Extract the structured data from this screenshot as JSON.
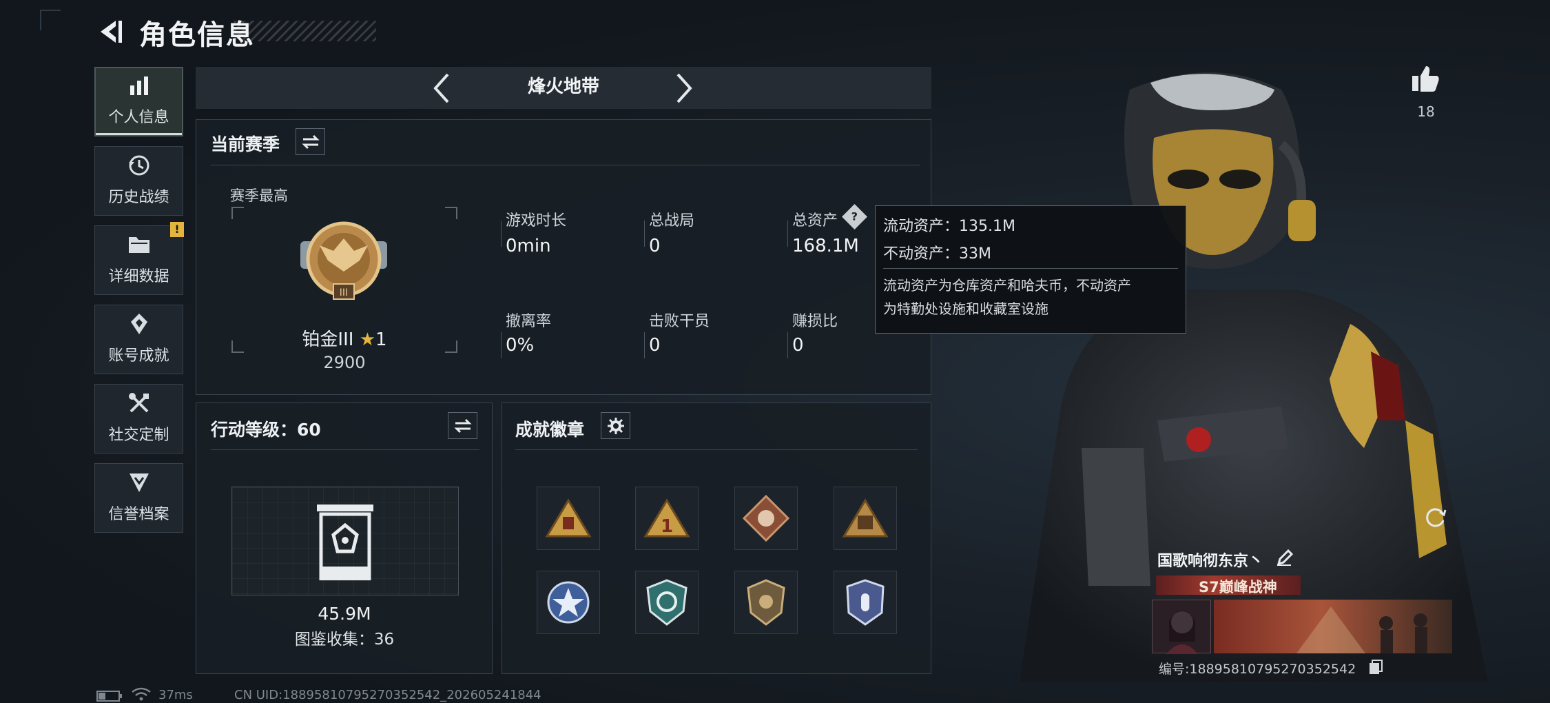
{
  "header": {
    "title": "角色信息"
  },
  "sidebar": {
    "items": [
      {
        "label": "个人信息",
        "icon": "bar-chart-icon"
      },
      {
        "label": "历史战绩",
        "icon": "history-icon"
      },
      {
        "label": "详细数据",
        "icon": "folder-icon",
        "badge": "!"
      },
      {
        "label": "账号成就",
        "icon": "achievement-icon"
      },
      {
        "label": "社交定制",
        "icon": "tools-icon"
      },
      {
        "label": "信誉档案",
        "icon": "credit-icon"
      }
    ]
  },
  "mode": {
    "title": "烽火地带"
  },
  "season": {
    "title": "当前赛季",
    "best_label": "赛季最高",
    "rank_name": "铂金III",
    "rank_stars": "1",
    "rank_score": "2900",
    "stats": [
      {
        "label": "游戏时长",
        "value": "0min"
      },
      {
        "label": "总战局",
        "value": "0"
      },
      {
        "label": "总资产",
        "value": "168.1M",
        "help": "?"
      },
      {
        "label": "撤离率",
        "value": "0%"
      },
      {
        "label": "击败干员",
        "value": "0"
      },
      {
        "label": "赚损比",
        "value": "0"
      }
    ]
  },
  "tooltip": {
    "liquid": "流动资产：135.1M",
    "fixed": "不动资产：33M",
    "desc_line1": "流动资产为仓库资产和哈夫币，不动资产",
    "desc_line2": "为特勤处设施和收藏室设施"
  },
  "action": {
    "title": "行动等级：60",
    "value": "45.9M",
    "collection": "图鉴收集：36"
  },
  "badges": {
    "title": "成就徽章",
    "items": [
      "triangle-gold-badge-icon",
      "triangle-number-one-badge-icon",
      "diamond-wolf-badge-icon",
      "triangle-crate-badge-icon",
      "star-shield-badge-icon",
      "arrows-shield-badge-icon",
      "eye-shield-badge-icon",
      "blue-shield-badge-icon"
    ]
  },
  "likes": {
    "count": "18"
  },
  "character": {
    "name": "国歌响彻东京丶",
    "title": "S7巅峰战神",
    "id_text": "编号:1889581079527035254​2"
  },
  "status": {
    "ping": "37ms",
    "uid": "CN UID:1889581079527035254​2_202605241844"
  },
  "colors": {
    "accent": "#e3b53c",
    "panel": "#181e25",
    "border": "#39434d"
  }
}
